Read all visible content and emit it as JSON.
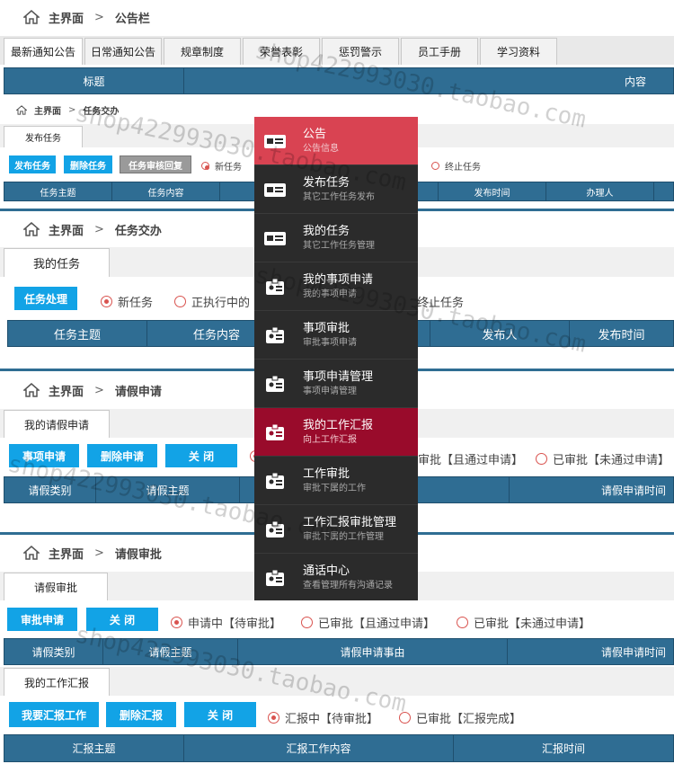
{
  "s1": {
    "home": "主界面",
    "crumb": "公告栏",
    "tabs": [
      "最新通知公告",
      "日常通知公告",
      "规章制度",
      "荣誉表彰",
      "惩罚警示",
      "员工手册",
      "学习资料"
    ],
    "cols": [
      "标题",
      "内容"
    ]
  },
  "s2": {
    "home": "主界面",
    "crumb": "任务交办",
    "tab": "发布任务",
    "btns": [
      "发布任务",
      "删除任务",
      "任务审核回复"
    ],
    "radios": [
      "新任务",
      "终止任务"
    ],
    "cols": [
      "任务主题",
      "任务内容",
      "发布时间",
      "办理人"
    ]
  },
  "s3": {
    "home": "主界面",
    "crumb": "任务交办",
    "tab": "我的任务",
    "btn": "任务处理",
    "radios": [
      "新任务",
      "正执行中的",
      "终止任务"
    ],
    "cols": [
      "任务主题",
      "任务内容",
      "发布人",
      "发布时间"
    ]
  },
  "s4": {
    "home": "主界面",
    "crumb": "请假申请",
    "tab": "我的请假申请",
    "btns": [
      "事项申请",
      "删除申请",
      "关  闭"
    ],
    "radios": [
      "审批【且通过申请】",
      "已审批【未通过申请】"
    ],
    "cols": [
      "请假类别",
      "请假主题",
      "请假申请时间"
    ]
  },
  "s5": {
    "home": "主界面",
    "crumb": "请假审批",
    "tab": "请假审批",
    "btns": [
      "审批申请",
      "关  闭"
    ],
    "radios": [
      "申请中【待审批】",
      "已审批【且通过申请】",
      "已审批【未通过申请】"
    ],
    "cols": [
      "请假类别",
      "请假主题",
      "请假申请事由",
      "请假申请时间"
    ]
  },
  "s6": {
    "tab": "我的工作汇报",
    "btns": [
      "我要汇报工作",
      "删除汇报",
      "关  闭"
    ],
    "radios": [
      "汇报中【待审批】",
      "已审批【汇报完成】"
    ],
    "cols": [
      "汇报主题",
      "汇报工作内容",
      "汇报时间"
    ]
  },
  "menu": [
    {
      "title": "公告",
      "sub": "公告信息"
    },
    {
      "title": "发布任务",
      "sub": "其它工作任务发布"
    },
    {
      "title": "我的任务",
      "sub": "其它工作任务管理"
    },
    {
      "title": "我的事项申请",
      "sub": "我的事项申请"
    },
    {
      "title": "事项审批",
      "sub": "审批事项申请"
    },
    {
      "title": "事项申请管理",
      "sub": "事项申请管理"
    },
    {
      "title": "我的工作汇报",
      "sub": "向上工作汇报"
    },
    {
      "title": "工作审批",
      "sub": "审批下属的工作"
    },
    {
      "title": "工作汇报审批管理",
      "sub": "审批下属的工作管理"
    },
    {
      "title": "通话中心",
      "sub": "查看管理所有沟通记录"
    }
  ],
  "watermark": "shop422993030.taobao.com",
  "colors": {
    "accent": "#12a3e6",
    "header": "#2f6d93",
    "menu": "#2b2b2b",
    "menu_active": "#d94352",
    "menu_selected": "#990b2b"
  }
}
